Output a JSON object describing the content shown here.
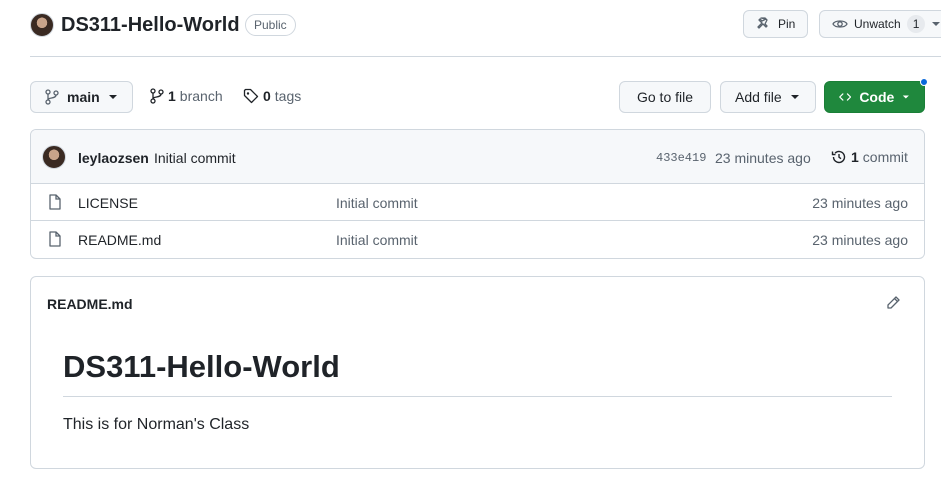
{
  "repo": {
    "name": "DS311-Hello-World",
    "visibility": "Public",
    "pin_label": "Pin",
    "unwatch_label": "Unwatch",
    "watch_count": "1"
  },
  "toolbar": {
    "branch": "main",
    "branch_count": "1",
    "branch_word": "branch",
    "tag_count": "0",
    "tag_word": "tags",
    "goto_label": "Go to file",
    "addfile_label": "Add file",
    "code_label": "Code"
  },
  "latest_commit": {
    "author": "leylaozsen",
    "message": "Initial commit",
    "sha": "433e419",
    "time": "23 minutes ago",
    "count": "1",
    "count_word": "commit"
  },
  "files": [
    {
      "name": "LICENSE",
      "commit": "Initial commit",
      "time": "23 minutes ago"
    },
    {
      "name": "README.md",
      "commit": "Initial commit",
      "time": "23 minutes ago"
    }
  ],
  "readme": {
    "filename": "README.md",
    "heading": "DS311-Hello-World",
    "body": "This is for Norman's Class"
  },
  "colors": {
    "primary_green": "#1f883d",
    "border": "#d0d7de",
    "muted_text": "#59636e",
    "notification_blue": "#0969da"
  },
  "icons": [
    "pin-icon",
    "eye-icon",
    "caret-down-icon",
    "git-branch-icon",
    "tag-icon",
    "code-icon",
    "history-icon",
    "file-icon",
    "pencil-icon"
  ]
}
